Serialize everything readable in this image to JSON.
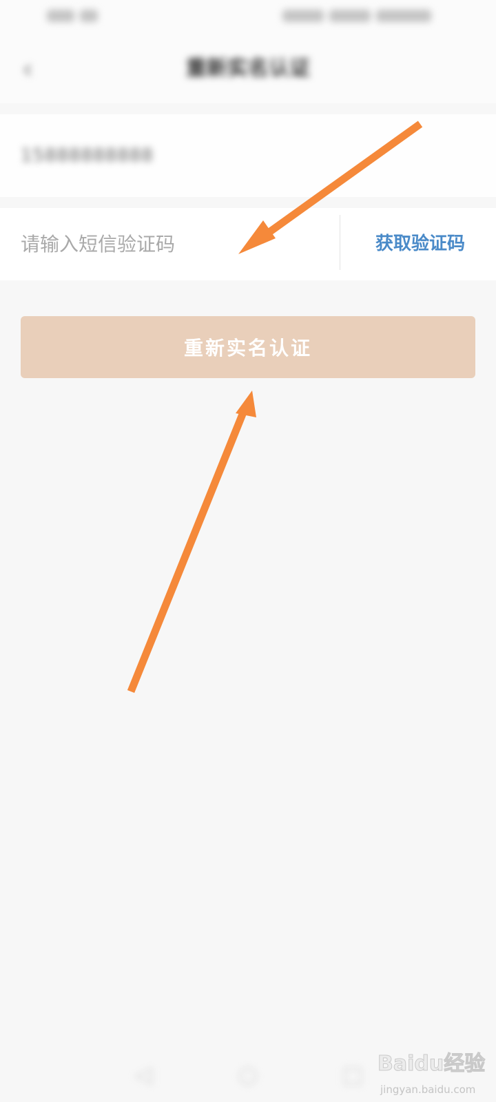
{
  "status_bar": {
    "left_text": "",
    "right_text": ""
  },
  "header": {
    "back_icon": "chevron-left-icon",
    "title": "重新实名认证"
  },
  "form": {
    "phone_value": "15888888888",
    "code_placeholder": "请输入短信验证码",
    "code_value": "",
    "get_code_label": "获取验证码",
    "submit_label": "重新实名认证"
  },
  "nav_bar": {
    "icons": [
      "back-triangle-icon",
      "home-circle-icon",
      "recent-square-icon"
    ]
  },
  "watermark": {
    "logo_text": "Baidu经验",
    "url_text": "jingyan.baidu.com"
  },
  "colors": {
    "accent_link": "#4a8ac8",
    "submit_bg": "#e9cfba",
    "arrow": "#f5893a",
    "page_bg": "#f7f7f7"
  }
}
